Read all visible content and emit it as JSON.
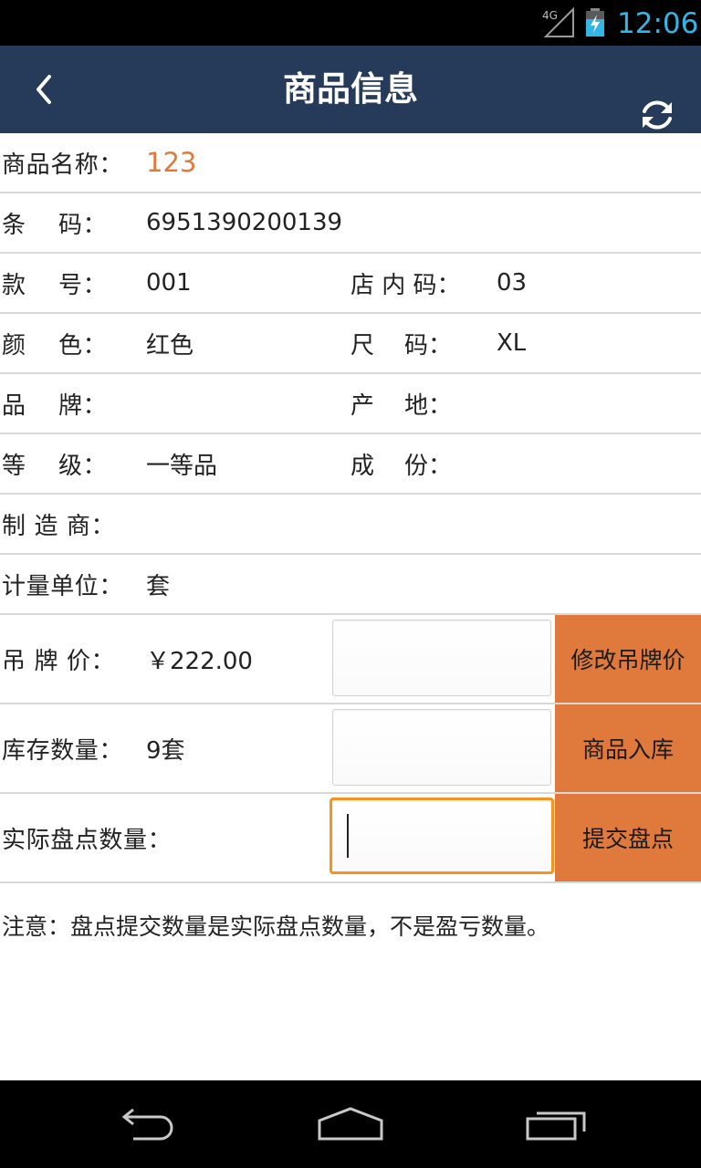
{
  "status_bar": {
    "network": "4G",
    "time": "12:06",
    "accent_color": "#33b5e5"
  },
  "header": {
    "title": "商品信息",
    "back_icon": "chevron-left-icon",
    "refresh_icon": "refresh-icon",
    "background_color": "#263a5a"
  },
  "fields": {
    "name": {
      "label": "商品名称：",
      "value": "123"
    },
    "barcode": {
      "label": "条    码：",
      "value": "6951390200139"
    },
    "style_no": {
      "label": "款    号：",
      "value": "001"
    },
    "store_code": {
      "label": "店 内 码：",
      "value": "03"
    },
    "color": {
      "label": "颜    色：",
      "value": "红色"
    },
    "size": {
      "label": "尺    码：",
      "value": "XL"
    },
    "brand": {
      "label": "品    牌：",
      "value": ""
    },
    "origin": {
      "label": "产    地：",
      "value": ""
    },
    "grade": {
      "label": "等    级：",
      "value": "一等品"
    },
    "composition": {
      "label": "成    份：",
      "value": ""
    },
    "manufacturer": {
      "label": "制 造 商：",
      "value": ""
    },
    "unit": {
      "label": "计量单位：",
      "value": "套"
    },
    "tag_price": {
      "label": "吊 牌 价：",
      "value": "￥222.00",
      "input_value": "",
      "button": "修改吊牌价"
    },
    "stock_qty": {
      "label": "库存数量：",
      "value": "9套",
      "input_value": "",
      "button": "商品入库"
    },
    "actual_qty": {
      "label": "实际盘点数量：",
      "input_value": "",
      "button": "提交盘点"
    }
  },
  "note": "注意：盘点提交数量是实际盘点数量，不是盈亏数量。",
  "colors": {
    "value_highlight": "#e07a3c",
    "button_bg": "#e07a3c",
    "focus_border": "#f7941d"
  },
  "nav_bar": {
    "back_icon": "back-arrow-icon",
    "home_icon": "home-icon",
    "recent_icon": "recent-apps-icon"
  }
}
